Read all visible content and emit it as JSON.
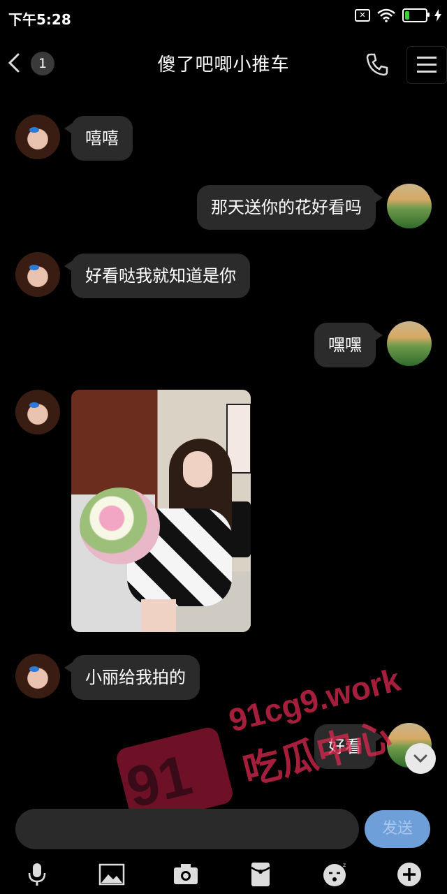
{
  "status_bar": {
    "time": "下午5:28",
    "battery_level": "21",
    "battery_fraction": 0.21,
    "icons": [
      "no-sim-icon",
      "wifi-icon",
      "battery-icon",
      "charging-icon"
    ]
  },
  "nav": {
    "unread_count": "1",
    "title": "傻了吧唧小推车",
    "icons": [
      "back-arrow-icon",
      "phone-icon",
      "menu-icon"
    ]
  },
  "messages": [
    {
      "side": "left",
      "type": "text",
      "text": "嘻嘻"
    },
    {
      "side": "right",
      "type": "text",
      "text": "那天送你的花好看吗"
    },
    {
      "side": "left",
      "type": "text",
      "text": "好看哒我就知道是你"
    },
    {
      "side": "right",
      "type": "text",
      "text": "嘿嘿"
    },
    {
      "side": "left",
      "type": "image"
    },
    {
      "side": "left",
      "type": "text",
      "text": "小丽给我拍的"
    },
    {
      "side": "right",
      "type": "text",
      "text": "好看"
    }
  ],
  "watermark": {
    "logo_number": "91",
    "domain": "91cg9.work",
    "name": "吃瓜中心"
  },
  "input": {
    "placeholder": "",
    "send_label": "发送"
  },
  "toolbar": {
    "icons": [
      "microphone-icon",
      "gallery-icon",
      "camera-icon",
      "red-packet-icon",
      "emoji-icon",
      "plus-icon"
    ]
  },
  "colors": {
    "background": "#000000",
    "bubble": "#2b2b2b",
    "send_button": "#6f9fd8",
    "battery": "#3ad13a"
  }
}
